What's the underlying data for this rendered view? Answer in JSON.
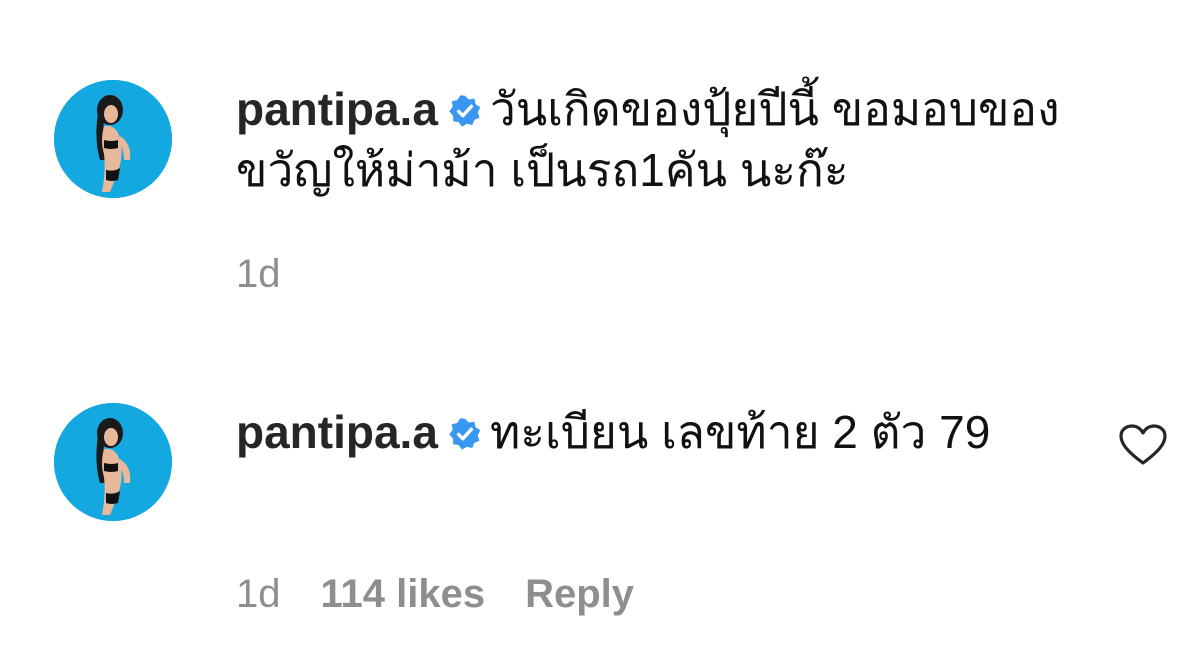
{
  "colors": {
    "avatar_bg": "#13a8e0",
    "verified_badge": "#3897f0",
    "meta_text": "#8e8e8e"
  },
  "comments": [
    {
      "username": "pantipa.a",
      "verified_icon": "verified-badge-icon",
      "text": "วันเกิดของปุ้ยปีนี้ ขอมอบของขวัญให้ม่าม้า เป็นรถ1คัน นะก๊ะ",
      "time": "1d"
    },
    {
      "username": "pantipa.a",
      "verified_icon": "verified-badge-icon",
      "text": "ทะเบียน เลขท้าย 2 ตัว 79",
      "time": "1d",
      "likes": "114 likes",
      "reply": "Reply",
      "like_icon": "heart-icon"
    }
  ]
}
